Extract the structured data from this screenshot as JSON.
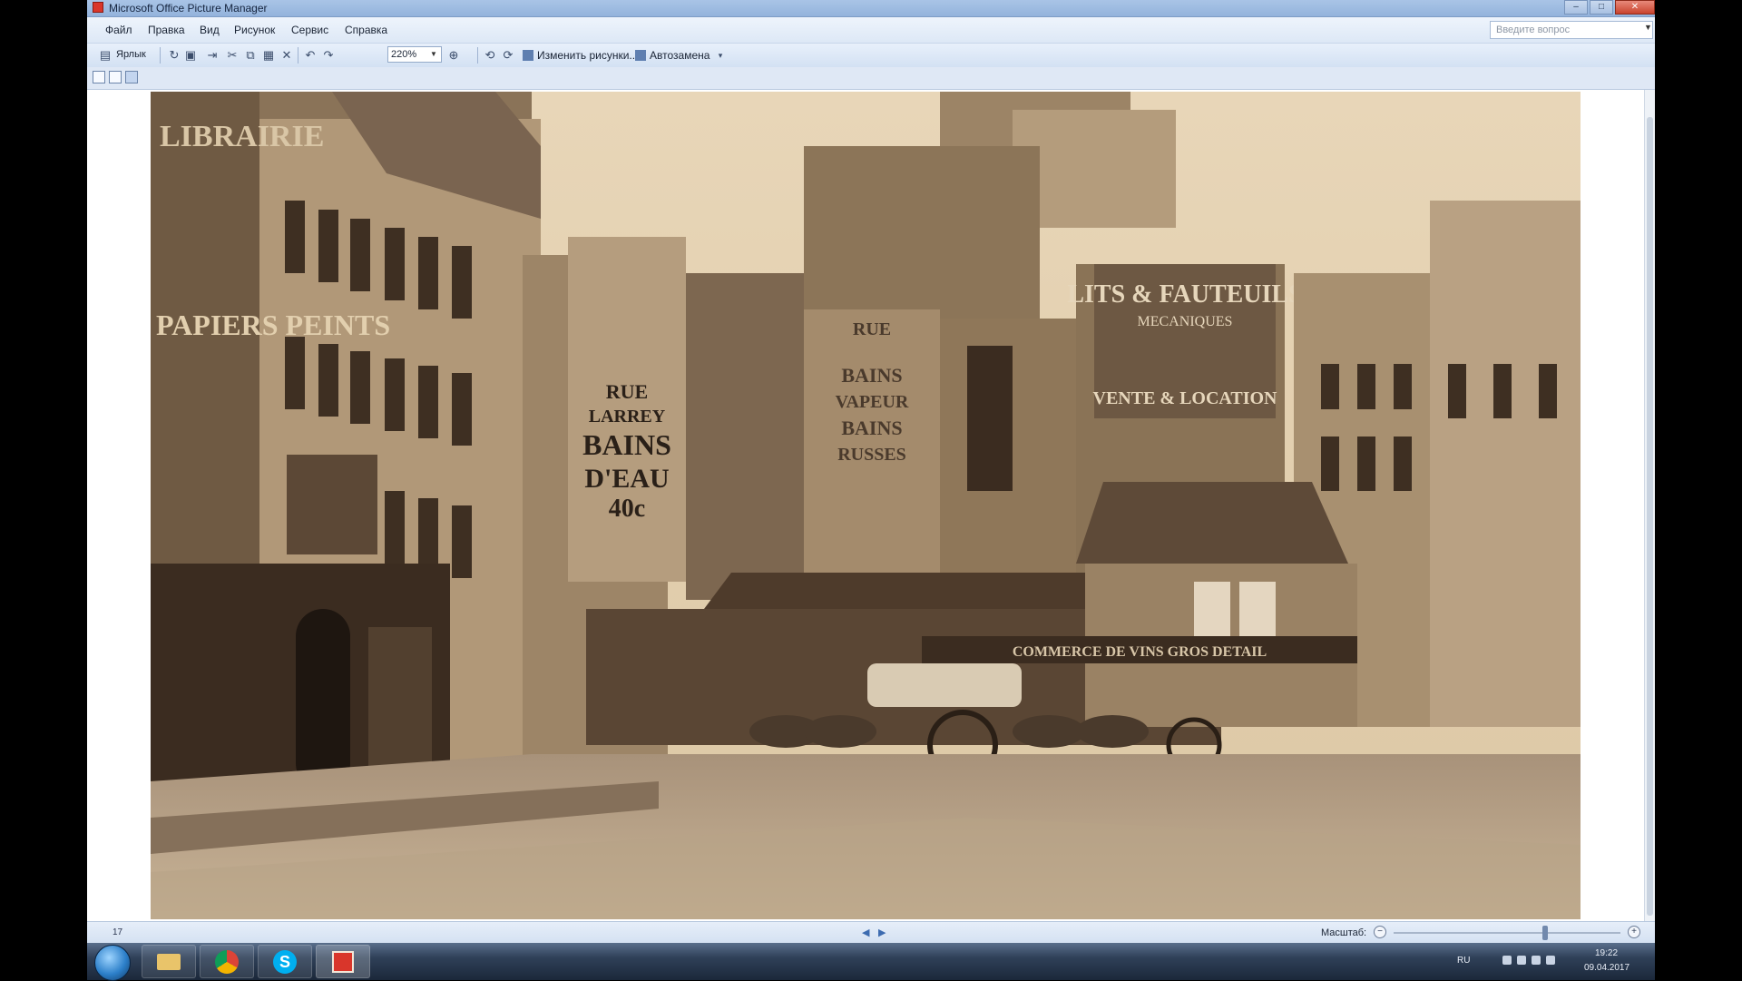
{
  "window": {
    "title": "Microsoft Office Picture Manager",
    "controls": [
      "–",
      "□",
      "✕"
    ]
  },
  "menu": {
    "items": [
      "Файл",
      "Правка",
      "Вид",
      "Рисунок",
      "Сервис",
      "Справка"
    ]
  },
  "help_box": {
    "placeholder": "Введите вопрос"
  },
  "toolbar": {
    "open_label": "Ярлык",
    "zoom_value": "220%",
    "edit_pictures_label": "Изменить рисунки...",
    "autocorrect_label": "Автозамена"
  },
  "photo": {
    "sign_rue_larrey": [
      "RUE",
      "LARREY",
      "BAINS",
      "D'EAU",
      "40c"
    ],
    "sign_bains_vapeur": [
      "RUE",
      "BAINS",
      "VAPEUR",
      "BAINS",
      "RUSSES"
    ],
    "sign_lits_fauteuils": [
      "LITS & FAUTEUILS",
      "MECANIQUES",
      "VENTE & LOCATION"
    ],
    "sign_commerce": "COMMERCE DE VINS GROS DETAIL",
    "sign_left_top": "LIBRAIRIE",
    "sign_left_mid": "PAPIERS PEINTS"
  },
  "status": {
    "page_number": "17",
    "zoom_label": "Масштаб:"
  },
  "taskbar": {
    "lang": "RU",
    "time": "19:22",
    "date": "09.04.2017"
  }
}
